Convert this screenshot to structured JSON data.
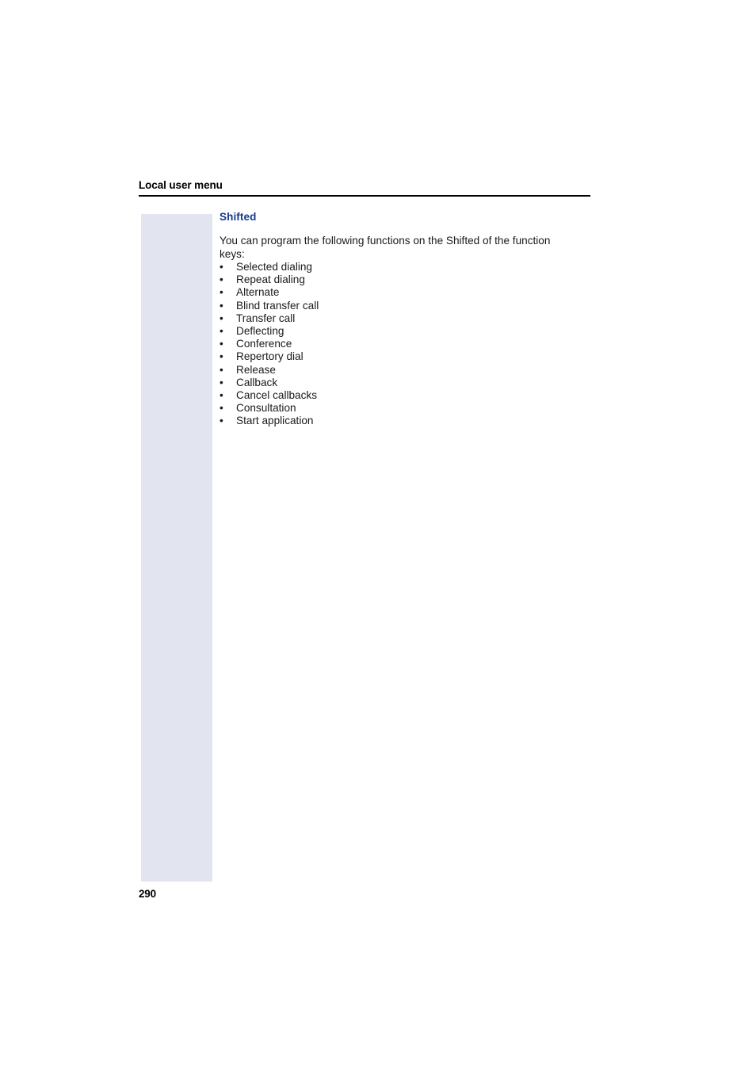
{
  "document": {
    "running_header": "Local user menu",
    "page_number": "290"
  },
  "section": {
    "heading": "Shifted",
    "heading_color": "#17398c",
    "intro_paragraph": "You can program the following functions on the Shifted of the function keys:",
    "function_list": [
      "Selected dialing",
      "Repeat dialing",
      "Alternate",
      "Blind transfer call",
      "Transfer call",
      "Deflecting",
      "Conference",
      "Repertory dial",
      "Release",
      "Callback",
      "Cancel callbacks",
      "Consultation",
      "Start application"
    ],
    "bullet_glyph": "•"
  },
  "style": {
    "margin_block_color": "#e2e5f0",
    "rule_color": "#000000",
    "text_color": "#1a1a1a"
  }
}
